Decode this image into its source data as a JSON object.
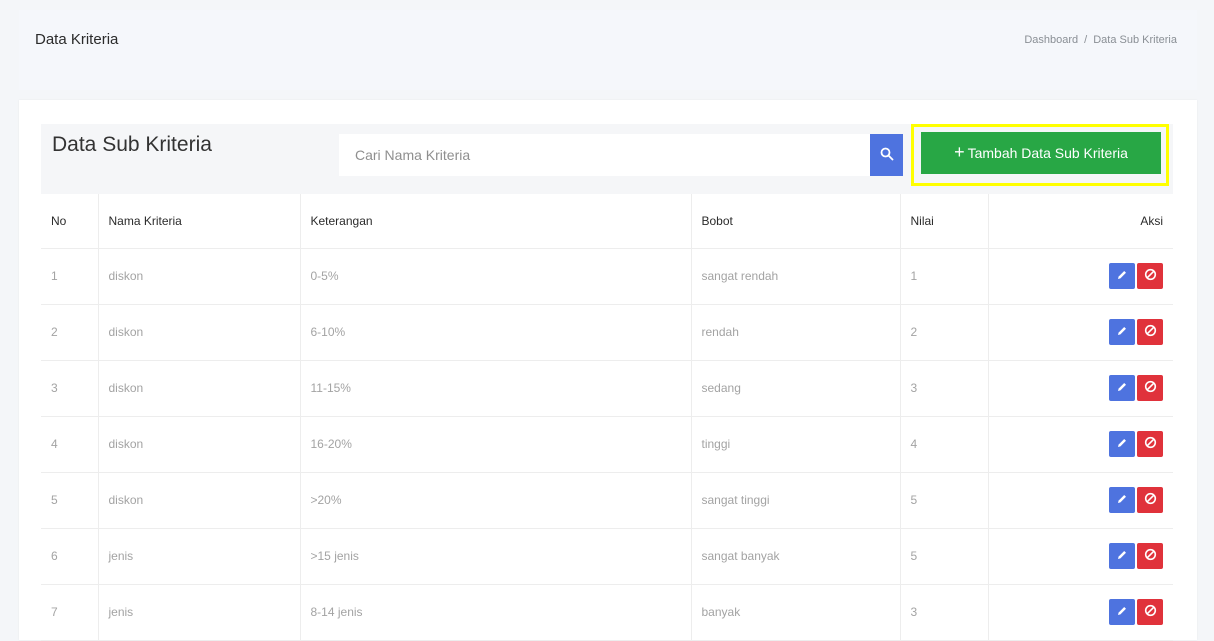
{
  "header": {
    "title": "Data Kriteria",
    "breadcrumb": [
      "Dashboard",
      "Data Sub Kriteria"
    ],
    "breadcrumb_separator": "/"
  },
  "toolbar": {
    "title": "Data Sub Kriteria",
    "search_placeholder": "Cari Nama Kriteria",
    "add_label": "Tambah Data Sub Kriteria",
    "add_icon": "plus-icon",
    "search_icon": "search-icon"
  },
  "colors": {
    "primary": "#4e73df",
    "success": "#28a745",
    "danger": "#e0323b",
    "highlight": "#ffff00"
  },
  "table": {
    "columns": [
      "No",
      "Nama Kriteria",
      "Keterangan",
      "Bobot",
      "Nilai",
      "Aksi"
    ],
    "rows": [
      [
        "1",
        "diskon",
        "0-5%",
        "sangat rendah",
        "1"
      ],
      [
        "2",
        "diskon",
        "6-10%",
        "rendah",
        "2"
      ],
      [
        "3",
        "diskon",
        "11-15%",
        "sedang",
        "3"
      ],
      [
        "4",
        "diskon",
        "16-20%",
        "tinggi",
        "4"
      ],
      [
        "5",
        "diskon",
        ">20%",
        "sangat tinggi",
        "5"
      ],
      [
        "6",
        "jenis",
        ">15 jenis",
        "sangat banyak",
        "5"
      ],
      [
        "7",
        "jenis",
        "8-14 jenis",
        "banyak",
        "3"
      ]
    ],
    "row_actions": [
      "edit-icon",
      "delete-icon"
    ]
  }
}
